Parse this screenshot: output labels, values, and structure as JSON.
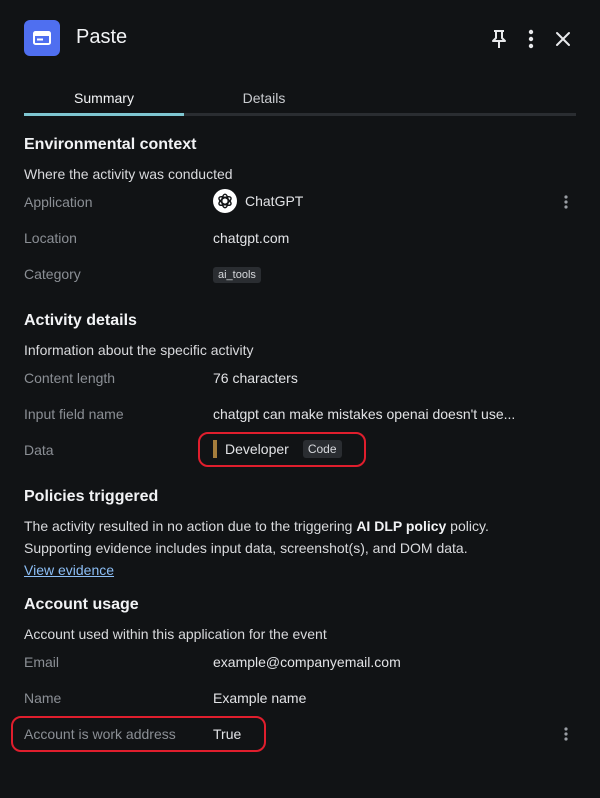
{
  "header": {
    "title": "Paste",
    "icon": "window-icon",
    "accent": "#4f6ff0"
  },
  "tabs": [
    {
      "label": "Summary",
      "active": true
    },
    {
      "label": "Details",
      "active": false
    }
  ],
  "environmental": {
    "title": "Environmental context",
    "description": "Where the activity was conducted",
    "rows": {
      "application": {
        "label": "Application",
        "value": "ChatGPT"
      },
      "location": {
        "label": "Location",
        "value": "chatgpt.com"
      },
      "category": {
        "label": "Category",
        "value": "ai_tools"
      }
    }
  },
  "activity": {
    "title": "Activity details",
    "description": "Information about the specific activity",
    "rows": {
      "content_length": {
        "label": "Content length",
        "value": "76 characters"
      },
      "input_field": {
        "label": "Input field name",
        "value": "chatgpt can make mistakes openai doesn't use..."
      },
      "data": {
        "label": "Data",
        "value": "Developer",
        "tag": "Code"
      }
    }
  },
  "policies": {
    "title": "Policies triggered",
    "text_before": "The activity resulted in no action due to the triggering ",
    "policy_name": "AI DLP policy",
    "text_after": " policy.",
    "line2": "Supporting evidence includes input data, screenshot(s), and DOM data.",
    "link": "View evidence"
  },
  "account": {
    "title": "Account usage",
    "description": "Account used within this application for the event",
    "rows": {
      "email": {
        "label": "Email",
        "value": "example@companyemail.com"
      },
      "name": {
        "label": "Name",
        "value": "Example name"
      },
      "work": {
        "label": "Account is work address",
        "value": "True"
      }
    }
  },
  "colors": {
    "background": "#111315",
    "highlight": "#e01e2d",
    "tab_indicator": "#7fc6d1",
    "link": "#8cbef5"
  }
}
